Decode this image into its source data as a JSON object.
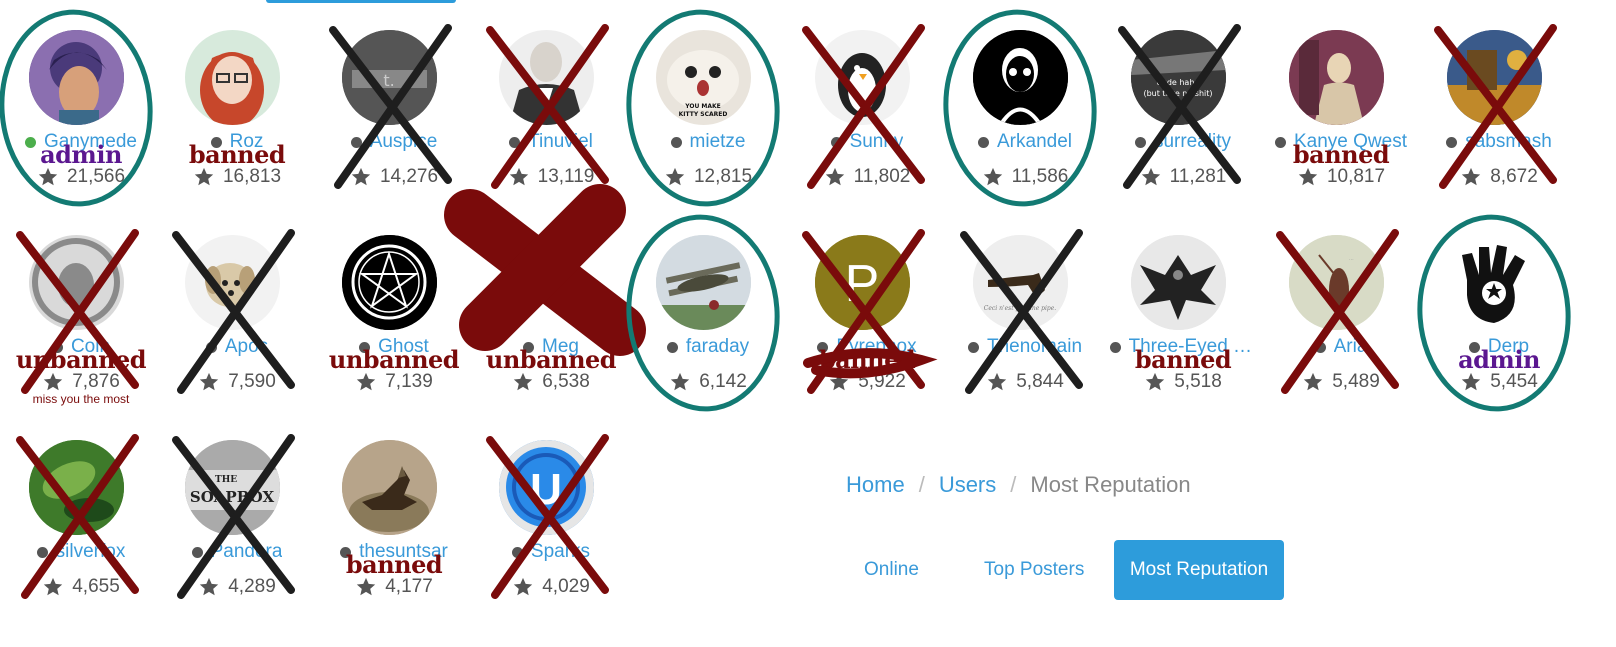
{
  "users": [
    {
      "name": "Ganymede",
      "rep": "21,566",
      "online": true,
      "tag": "admin",
      "circled": true,
      "avatar": {
        "icon": "anime-character",
        "colors": [
          "#4a3a7a",
          "#7a5f9a",
          "#c9a0a0"
        ]
      }
    },
    {
      "name": "Roz",
      "rep": "16,813",
      "online": false,
      "tag": "banned",
      "avatar": {
        "icon": "red-haired-girl",
        "colors": [
          "#d7eadc",
          "#c7472b",
          "#f3d7c5"
        ]
      }
    },
    {
      "name": "Auspice",
      "rep": "14,276",
      "online": false,
      "crossed": "black",
      "avatar": {
        "icon": "grey-text-image",
        "colors": [
          "#555",
          "#888",
          "#ccc"
        ]
      }
    },
    {
      "name": "Tinuviel",
      "rep": "13,119",
      "online": false,
      "crossed": "red",
      "avatar": {
        "icon": "suited-man",
        "colors": [
          "#eeeeee",
          "#cccccc",
          "#444"
        ]
      }
    },
    {
      "name": "mietze",
      "rep": "12,815",
      "online": false,
      "circled": true,
      "avatar": {
        "icon": "kitten",
        "caption": "YOU MAKE KITTY SCARED",
        "colors": [
          "#e9e4dc",
          "#a79a86",
          "#2a2a2a"
        ]
      }
    },
    {
      "name": "Sunny",
      "rep": "11,802",
      "online": false,
      "crossed": "red",
      "avatar": {
        "icon": "penguin",
        "colors": [
          "#f2f2f2",
          "#222",
          "#888"
        ]
      }
    },
    {
      "name": "Arkandel",
      "rep": "11,586",
      "online": false,
      "circled": true,
      "avatar": {
        "icon": "silhouette-with-glasses",
        "colors": [
          "#000",
          "#fff",
          "#000"
        ]
      }
    },
    {
      "name": "surreality",
      "rep": "11,281",
      "online": false,
      "crossed": "black",
      "avatar": {
        "icon": "text-on-dark",
        "caption": "dude haha (but take no shit)",
        "colors": [
          "#3a3a3a",
          "#777",
          "#fff"
        ]
      }
    },
    {
      "name": "Kanye Qwest",
      "rep": "10,817",
      "online": false,
      "tag": "banned",
      "avatar": {
        "icon": "painting-portrait",
        "colors": [
          "#7b3a52",
          "#d8c6a8",
          "#5a2a3a"
        ]
      }
    },
    {
      "name": "sabsmash",
      "rep": "8,672",
      "online": false,
      "crossed": "red",
      "avatar": {
        "icon": "gold-painting",
        "colors": [
          "#3a5a8a",
          "#c0892a",
          "#6a4a20"
        ]
      }
    },
    {
      "name": "Coin",
      "rep": "7,876",
      "online": false,
      "tag": "unbanned",
      "note": "miss you the most",
      "crossed": "red",
      "avatar": {
        "icon": "coin",
        "colors": [
          "#d9d9d9",
          "#8a8a8a",
          "#444"
        ]
      }
    },
    {
      "name": "Apos",
      "rep": "7,590",
      "online": false,
      "crossed": "black",
      "avatar": {
        "icon": "puppy",
        "colors": [
          "#f2f2f2",
          "#d9c9a8",
          "#555"
        ]
      }
    },
    {
      "name": "Ghost",
      "rep": "7,139",
      "online": false,
      "tag": "unbanned",
      "avatar": {
        "icon": "pentagram",
        "colors": [
          "#000",
          "#fff",
          "#000"
        ]
      }
    },
    {
      "name": "Meg",
      "rep": "6,538",
      "online": false,
      "tag": "unbanned",
      "blotted": true,
      "avatar": {
        "icon": "none",
        "colors": [
          "#fff",
          "#fff",
          "#fff"
        ]
      }
    },
    {
      "name": "faraday",
      "rep": "6,142",
      "online": false,
      "circled": true,
      "avatar": {
        "icon": "biplane",
        "colors": [
          "#d3dbe1",
          "#6a8a5a",
          "#8a2a2a"
        ]
      }
    },
    {
      "name": "Pyrephox",
      "rep": "5,922",
      "online": false,
      "tag": "banned",
      "crossed": "red",
      "scribbled": true,
      "avatar": {
        "icon": "letter-avatar",
        "letter": "P",
        "colors": [
          "#8a7a1a",
          "#8a7a1a",
          "#ffffff"
        ]
      }
    },
    {
      "name": "Thenomain",
      "rep": "5,844",
      "online": false,
      "crossed": "black",
      "avatar": {
        "icon": "pipe",
        "caption": "Ceci n'est pas une pipe.",
        "colors": [
          "#eeeeee",
          "#3a2a1a",
          "#777"
        ]
      }
    },
    {
      "name": "Three-Eyed Crow",
      "rep": "5,518",
      "online": false,
      "tag": "banned",
      "avatar": {
        "icon": "raven",
        "colors": [
          "#e8e8e8",
          "#222",
          "#666"
        ]
      }
    },
    {
      "name": "Aria",
      "rep": "5,489",
      "online": false,
      "crossed": "red",
      "avatar": {
        "icon": "sketch-figure",
        "colors": [
          "#d8dbc6",
          "#6a3a2a",
          "#999"
        ]
      }
    },
    {
      "name": "Derp",
      "rep": "5,454",
      "online": false,
      "tag": "admin",
      "circled": true,
      "avatar": {
        "icon": "black-hand",
        "colors": [
          "#ffffff",
          "#111",
          "#444"
        ]
      }
    },
    {
      "name": "silverfox",
      "rep": "4,655",
      "online": false,
      "crossed": "red",
      "avatar": {
        "icon": "green-lizard",
        "colors": [
          "#3e7a2a",
          "#7ab04a",
          "#1e4a1a"
        ]
      }
    },
    {
      "name": "Pandora",
      "rep": "4,289",
      "online": false,
      "crossed": "black",
      "avatar": {
        "icon": "soapbox",
        "caption": "THE SOAPBOX",
        "colors": [
          "#aaa",
          "#ddd",
          "#222"
        ]
      }
    },
    {
      "name": "thesuntsar",
      "rep": "4,177",
      "online": false,
      "tag": "banned",
      "avatar": {
        "icon": "dog-on-rocks",
        "colors": [
          "#b7a48a",
          "#6a5a40",
          "#3a2a1a"
        ]
      }
    },
    {
      "name": "Sparks",
      "rep": "4,029",
      "online": false,
      "crossed": "red",
      "avatar": {
        "icon": "blue-app-icon",
        "letter": "U",
        "colors": [
          "#2a8ae8",
          "#ffffff",
          "#1a5ab8"
        ]
      }
    }
  ],
  "breadcrumb": {
    "home": "Home",
    "users": "Users",
    "current": "Most Reputation",
    "separator": "/"
  },
  "tabs": {
    "online": "Online",
    "top_posters": "Top Posters",
    "most_reputation": "Most Reputation"
  },
  "colors": {
    "link": "#3a9ad9",
    "active_tab": "#2d9cdb",
    "circle": "#137a73",
    "cross_red": "#7a0b0b",
    "cross_black": "#1e1e1e",
    "admin": "#5b1790",
    "banned": "#7a0b0b"
  }
}
